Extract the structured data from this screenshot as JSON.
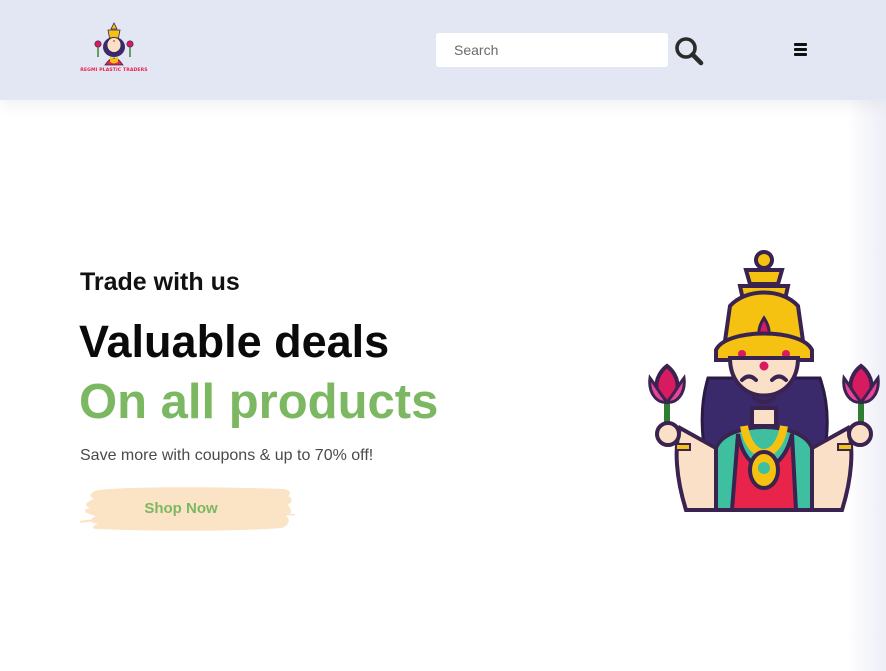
{
  "header": {
    "logo_text": "REGMI PLASTIC TRADERS",
    "search": {
      "placeholder": "Search",
      "value": ""
    },
    "search_icon": "search-icon",
    "menu_icon": "hamburger-menu-icon"
  },
  "hero": {
    "subtitle": "Trade with us",
    "title": "Valuable deals",
    "accent_title": "On all products",
    "description": "Save more with coupons & up to 70% off!",
    "cta_label": "Shop Now",
    "image_icon": "goddess-illustration"
  },
  "colors": {
    "header_bg": "#e3e6f3",
    "accent_green": "#7cb862",
    "button_bg": "#fbe3c5",
    "logo_text": "#e8244a"
  }
}
